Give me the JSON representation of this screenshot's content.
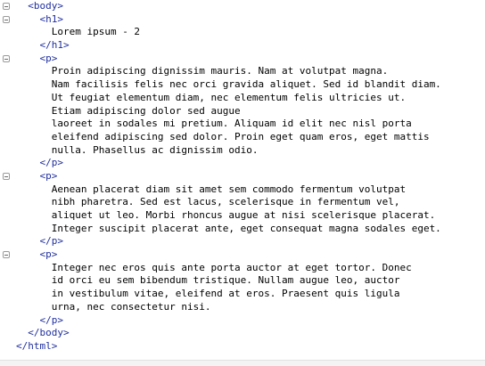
{
  "editor": {
    "lines": [
      {
        "kind": "tag",
        "indent": 2,
        "text": "<body>",
        "fold": true
      },
      {
        "kind": "tag",
        "indent": 4,
        "text": "<h1>",
        "fold": true
      },
      {
        "kind": "text",
        "indent": 6,
        "text": "Lorem ipsum - 2",
        "fold": false
      },
      {
        "kind": "tag",
        "indent": 4,
        "text": "</h1>",
        "fold": false
      },
      {
        "kind": "tag",
        "indent": 4,
        "text": "<p>",
        "fold": true
      },
      {
        "kind": "text",
        "indent": 6,
        "text": "Proin adipiscing dignissim mauris. Nam at volutpat magna.",
        "fold": false
      },
      {
        "kind": "text",
        "indent": 6,
        "text": "Nam facilisis felis nec orci gravida aliquet. Sed id blandit diam.",
        "fold": false
      },
      {
        "kind": "text",
        "indent": 6,
        "text": "Ut feugiat elementum diam, nec elementum felis ultricies ut.",
        "fold": false
      },
      {
        "kind": "text",
        "indent": 6,
        "text": "Etiam adipiscing dolor sed augue",
        "fold": false
      },
      {
        "kind": "text",
        "indent": 6,
        "text": "laoreet in sodales mi pretium. Aliquam id elit nec nisl porta",
        "fold": false
      },
      {
        "kind": "text",
        "indent": 6,
        "text": "eleifend adipiscing sed dolor. Proin eget quam eros, eget mattis",
        "fold": false
      },
      {
        "kind": "text",
        "indent": 6,
        "text": "nulla. Phasellus ac dignissim odio.",
        "fold": false
      },
      {
        "kind": "tag",
        "indent": 4,
        "text": "</p>",
        "fold": false
      },
      {
        "kind": "tag",
        "indent": 4,
        "text": "<p>",
        "fold": true
      },
      {
        "kind": "text",
        "indent": 6,
        "text": "Aenean placerat diam sit amet sem commodo fermentum volutpat",
        "fold": false
      },
      {
        "kind": "text",
        "indent": 6,
        "text": "nibh pharetra. Sed est lacus, scelerisque in fermentum vel,",
        "fold": false
      },
      {
        "kind": "text",
        "indent": 6,
        "text": "aliquet ut leo. Morbi rhoncus augue at nisi scelerisque placerat.",
        "fold": false
      },
      {
        "kind": "text",
        "indent": 6,
        "text": "Integer suscipit placerat ante, eget consequat magna sodales eget.",
        "fold": false
      },
      {
        "kind": "tag",
        "indent": 4,
        "text": "</p>",
        "fold": false
      },
      {
        "kind": "tag",
        "indent": 4,
        "text": "<p>",
        "fold": true
      },
      {
        "kind": "text",
        "indent": 6,
        "text": "Integer nec eros quis ante porta auctor at eget tortor. Donec",
        "fold": false
      },
      {
        "kind": "text",
        "indent": 6,
        "text": "id orci eu sem bibendum tristique. Nullam augue leo, auctor",
        "fold": false
      },
      {
        "kind": "text",
        "indent": 6,
        "text": "in vestibulum vitae, eleifend at eros. Praesent quis ligula",
        "fold": false
      },
      {
        "kind": "text",
        "indent": 6,
        "text": "urna, nec consectetur nisi.",
        "fold": false
      },
      {
        "kind": "tag",
        "indent": 4,
        "text": "</p>",
        "fold": false
      },
      {
        "kind": "tag",
        "indent": 2,
        "text": "</body>",
        "fold": false
      },
      {
        "kind": "tag",
        "indent": 0,
        "text": "</html>",
        "fold": false
      }
    ]
  }
}
